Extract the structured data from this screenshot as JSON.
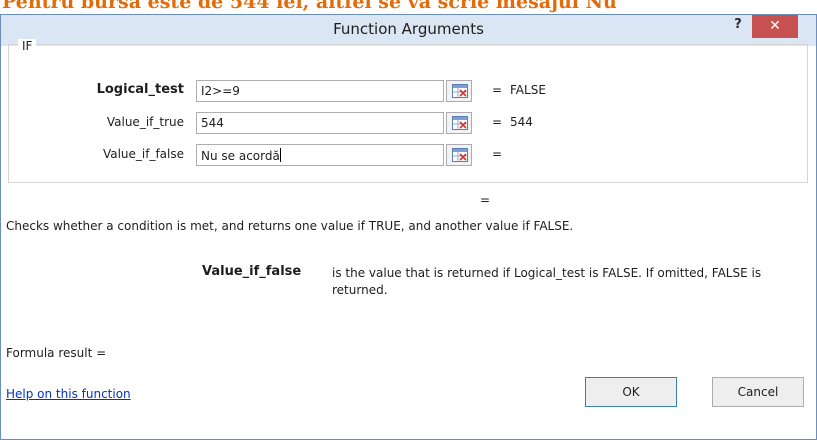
{
  "background": {
    "text": "Pentru bursa este de 544 lei, altfel se va scrie mesajul Nu"
  },
  "dialog": {
    "title": "Function Arguments",
    "help_label": "?",
    "close_label": "✕",
    "function_name": "IF",
    "arguments": [
      {
        "label": "Logical_test",
        "value": "I2>=9",
        "result_eq": "=",
        "result": "FALSE"
      },
      {
        "label": "Value_if_true",
        "value": "544",
        "result_eq": "=",
        "result": "544"
      },
      {
        "label": "Value_if_false",
        "value": "Nu se acordă",
        "result_eq": "=",
        "result": ""
      }
    ],
    "overall_eq": "=",
    "description": "Checks whether a condition is met, and returns one value if TRUE, and another value if FALSE.",
    "arg_description": {
      "name": "Value_if_false",
      "text": "is the value that is returned if Logical_test is FALSE. If omitted, FALSE is returned."
    },
    "formula_result_label": "Formula result =",
    "help_link": "Help on this function",
    "ok_label": "OK",
    "cancel_label": "Cancel"
  },
  "icons": {
    "range_selector": "collapse-dialog-icon",
    "accent": "#c75050"
  }
}
